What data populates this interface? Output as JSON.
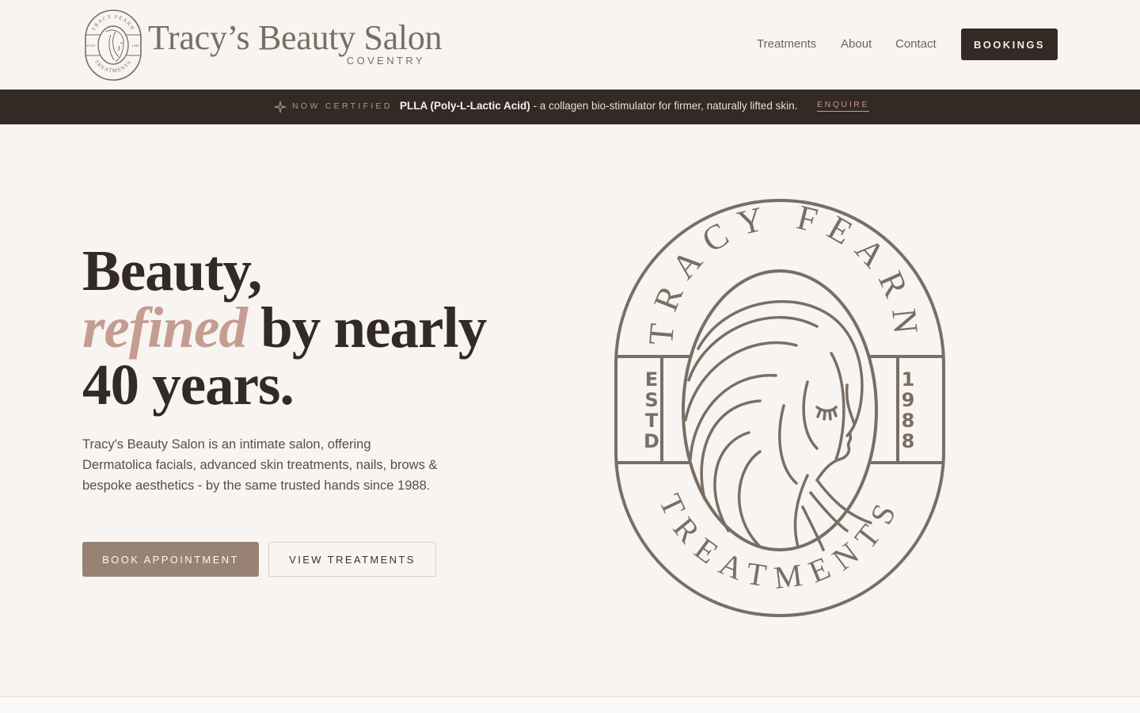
{
  "header": {
    "brand_name": "Tracy’s Beauty Salon",
    "brand_location": "COVENTRY",
    "logo_badge": {
      "top": "TRACY FEARN",
      "left": "ESTD",
      "right": "1988",
      "bottom": "TREATMENTS"
    },
    "nav": [
      {
        "label": "Treatments"
      },
      {
        "label": "About"
      },
      {
        "label": "Contact"
      }
    ],
    "bookings_label": "BOOKINGS"
  },
  "announcement": {
    "tag": "NOW CERTIFIED",
    "highlight": "PLLA (Poly-L-Lactic Acid)",
    "message": " - a collagen bio-stimulator for firmer, naturally lifted skin.",
    "link_label": "ENQUIRE"
  },
  "hero": {
    "title_line1": "Beauty,",
    "title_accent": "refined",
    "title_rest": " by nearly",
    "title_line3": "40 years.",
    "description": "Tracy's Beauty Salon is an intimate salon, offering Dermatolica facials, advanced skin treatments, nails, brows & bespoke aesthetics - by the same trusted hands since 1988.",
    "primary_button": "BOOK APPOINTMENT",
    "secondary_button": "VIEW TREATMENTS"
  },
  "emblem": {
    "top_text": "TRACY FEARN",
    "bottom_text": "TREATMENTS",
    "left_letters": [
      "E",
      "S",
      "T",
      "D"
    ],
    "right_letters": [
      "1",
      "9",
      "8",
      "8"
    ]
  },
  "colors": {
    "background": "#f7f4f1",
    "dark": "#332925",
    "taupe": "#7a6e64",
    "accent_pink": "#c59c92",
    "button_taupe": "#978273"
  }
}
